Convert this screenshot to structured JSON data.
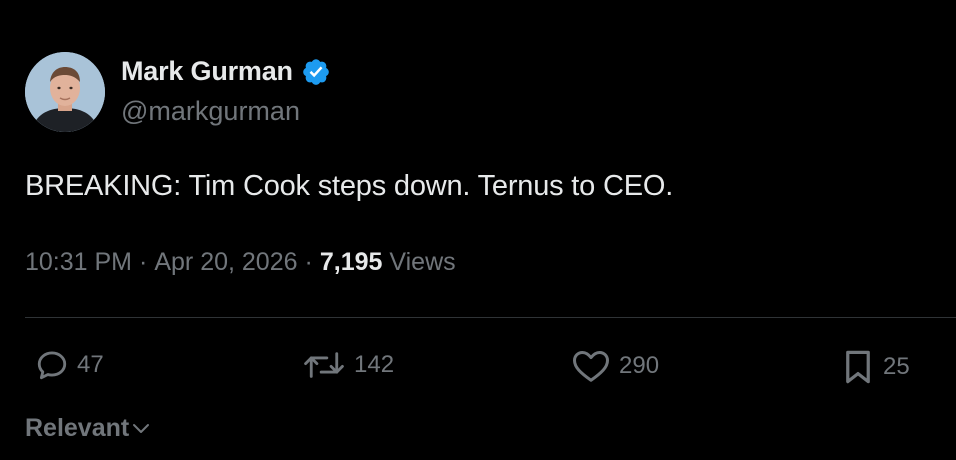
{
  "author": {
    "name": "Mark Gurman",
    "handle": "@markgurman",
    "verified_color": "#1d9bf0"
  },
  "tweet": {
    "text": "BREAKING: Tim Cook steps down. Ternus to CEO.",
    "time": "10:31 PM",
    "date": "Apr 20, 2026",
    "separator": "·",
    "views_count": "7,195",
    "views_label": "Views"
  },
  "actions": {
    "reply_count": "47",
    "retweet_count": "142",
    "like_count": "290",
    "bookmark_count": "25"
  },
  "replies_sort": {
    "label": "Relevant",
    "icon": "chevron-down-icon"
  },
  "colors": {
    "background": "#000000",
    "primary_text": "#e7e9ea",
    "secondary_text": "#71767b",
    "divider": "#2f3336"
  }
}
